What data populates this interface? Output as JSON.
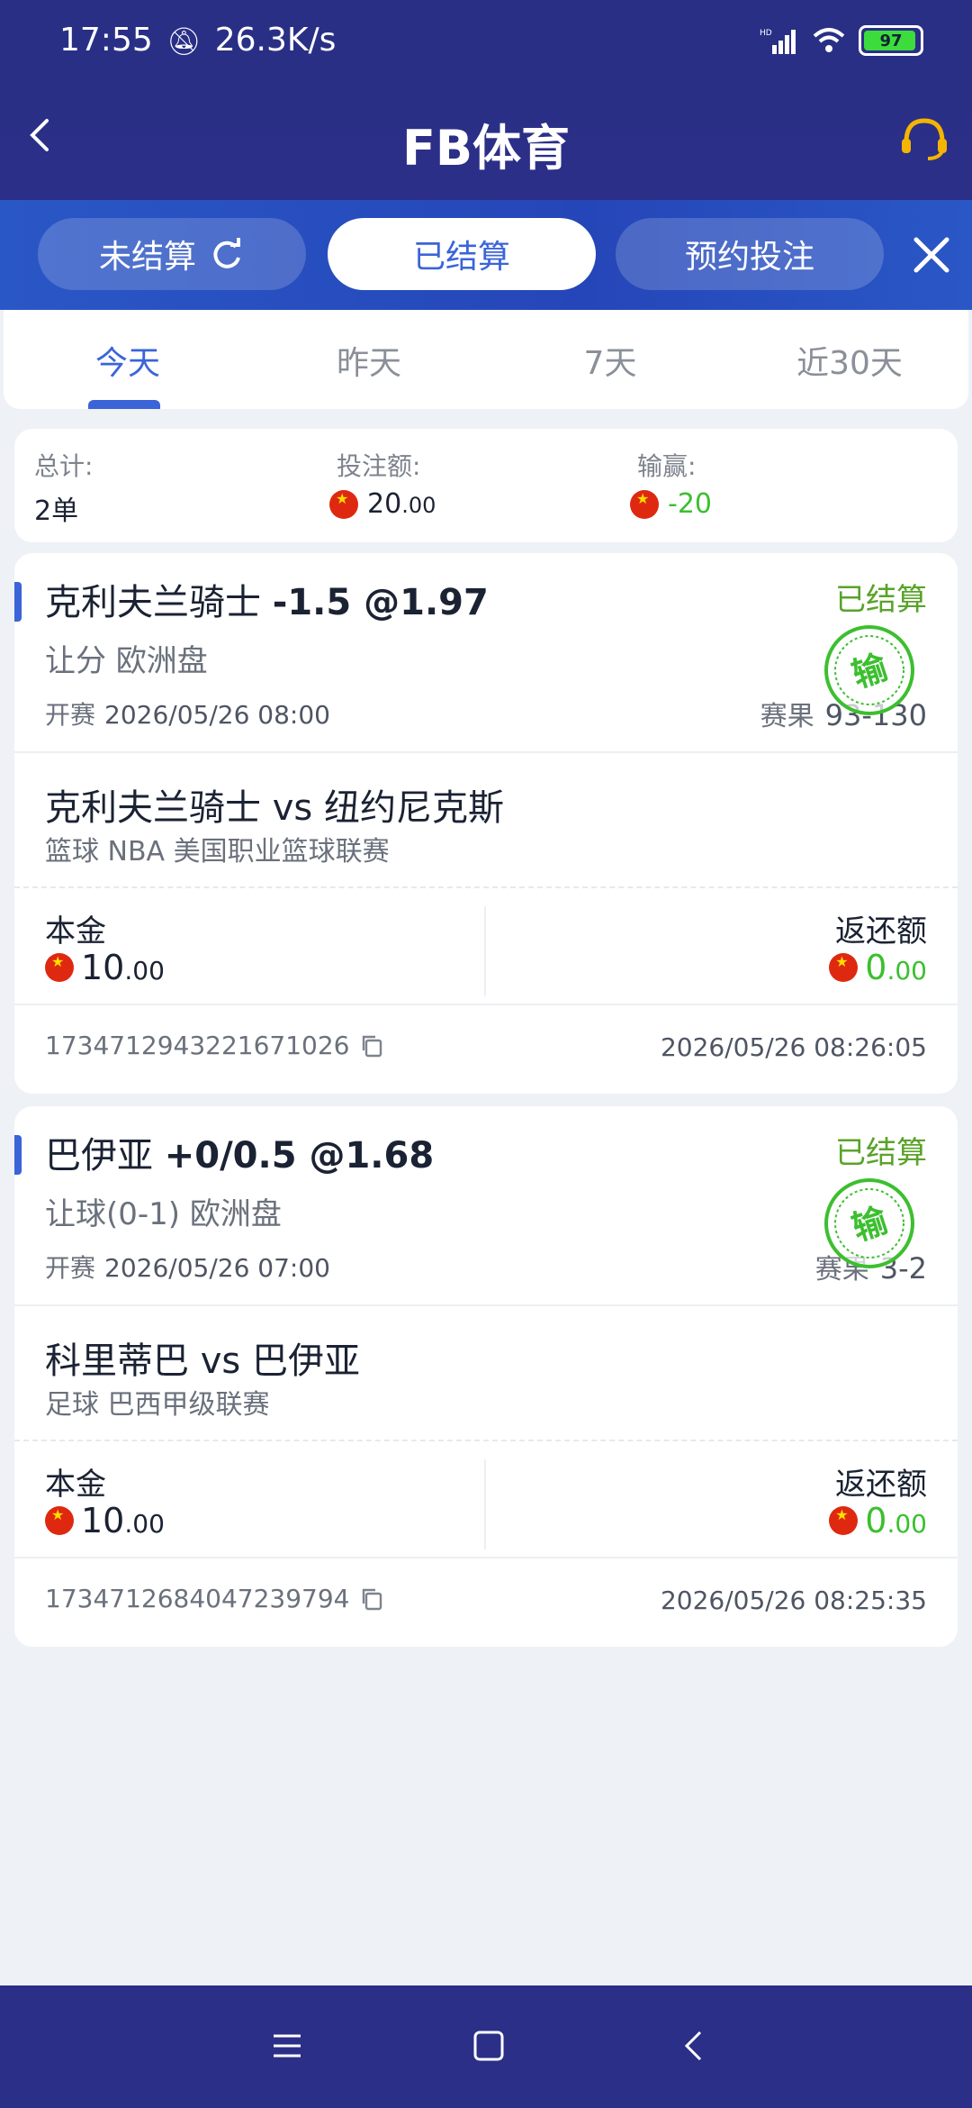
{
  "status_bar": {
    "time": "17:55",
    "speed": "26.3K/s",
    "battery": "97"
  },
  "header": {
    "title": "FB体育"
  },
  "segments": {
    "unsettled": "未结算",
    "settled": "已结算",
    "reserved": "预约投注"
  },
  "date_tabs": [
    "今天",
    "昨天",
    "7天",
    "近30天"
  ],
  "summary": {
    "total_label": "总计:",
    "total_value": "2单",
    "stake_label": "投注额:",
    "stake_int": "20",
    "stake_dec": ".00",
    "win_label": "输赢:",
    "win_value": "-20"
  },
  "bets": [
    {
      "team": "克利夫兰骑士",
      "line": "-1.5 @1.97",
      "status": "已结算",
      "market": "让分 欧洲盘",
      "kickoff_label": "开赛",
      "kickoff": "2026/05/26 08:00",
      "result_label": "赛果",
      "result": "93-130",
      "stamp": "输",
      "match": "克利夫兰骑士 vs 纽约尼克斯",
      "league": "篮球   NBA 美国职业篮球联赛",
      "stake_label": "本金",
      "stake_int": "10",
      "stake_dec": ".00",
      "return_label": "返还额",
      "return_int": "0",
      "return_dec": ".00",
      "order_id": "1734712943221671026",
      "order_time": "2026/05/26 08:26:05"
    },
    {
      "team": "巴伊亚",
      "line": "+0/0.5 @1.68",
      "status": "已结算",
      "market": "让球(0-1) 欧洲盘",
      "kickoff_label": "开赛",
      "kickoff": "2026/05/26 07:00",
      "result_label": "赛果",
      "result": "3-2",
      "stamp": "输",
      "match": "科里蒂巴 vs 巴伊亚",
      "league": "足球   巴西甲级联赛",
      "stake_label": "本金",
      "stake_int": "10",
      "stake_dec": ".00",
      "return_label": "返还额",
      "return_int": "0",
      "return_dec": ".00",
      "order_id": "1734712684047239794",
      "order_time": "2026/05/26 08:25:35"
    }
  ],
  "colors": {
    "header": "#2b2f87",
    "accent": "#3b64d8",
    "win_green": "#3cbf2f",
    "status_green": "#5aa32a"
  }
}
